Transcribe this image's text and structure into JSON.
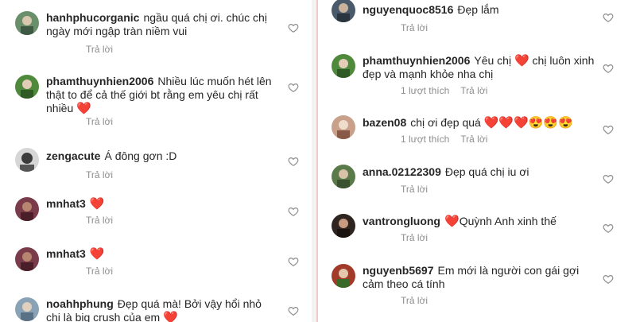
{
  "reply_label": "Trả lời",
  "left_comments": [
    {
      "username": "hanhphucorganic",
      "text": "ngầu quá chị ơi. chúc chị ngày mới ngập tràn niềm vui",
      "emoji": "",
      "likes": "",
      "avatar_color": "#6a8f6b"
    },
    {
      "username": "phamthuynhien2006",
      "text": "Nhiều lúc muốn hét lên thật to để cả thế giới bt rằng em yêu chị rất nhiều",
      "emoji": "❤️",
      "likes": "",
      "avatar_color": "#4f8a3c"
    },
    {
      "username": "zengacute",
      "text": "Á đông gơn :D",
      "emoji": "",
      "likes": "",
      "avatar_color": "#3b3b3b"
    },
    {
      "username": "mnhat3",
      "text": "",
      "emoji": "❤️",
      "likes": "",
      "avatar_color": "#7a3b4a"
    },
    {
      "username": "mnhat3",
      "text": "",
      "emoji": "❤️",
      "likes": "",
      "avatar_color": "#7a3b4a"
    },
    {
      "username": "noahhphung",
      "text": "Đẹp quá mà! Bởi vậy hổi nhỏ chị là big crush của em",
      "emoji": "❤️",
      "likes": "",
      "avatar_color": "#8aa2b5"
    }
  ],
  "right_comments": [
    {
      "username": "nguyenquoc8516",
      "text": "Đẹp lắm",
      "emoji": "",
      "likes": "",
      "avatar_color": "#4a5a6a"
    },
    {
      "username": "phamthuynhien2006",
      "text": "Yêu chị",
      "emoji": "❤️",
      "text_after": "chị luôn xinh đẹp và mạnh khỏe nha chị",
      "likes": "1 lượt thích",
      "avatar_color": "#4f8a3c"
    },
    {
      "username": "bazen08",
      "text": "chị ơi đẹp quá",
      "emoji": "❤️❤️❤️😍😍😍",
      "likes": "1 lượt thích",
      "avatar_color": "#c9a08a"
    },
    {
      "username": "anna.02122309",
      "text": "Đẹp quá chị iu ơi",
      "emoji": "",
      "likes": "",
      "avatar_color": "#5b7a4a"
    },
    {
      "username": "vantrongluong",
      "text": "Quỳnh Anh xinh thế",
      "emoji": "❤️",
      "emoji_first": true,
      "likes": "",
      "avatar_color": "#2e2420"
    },
    {
      "username": "nguyenb5697",
      "text": "Em mới là người con gái gợi cảm theo cá tính",
      "emoji": "",
      "likes": "",
      "avatar_color": "#a23a2a"
    }
  ]
}
